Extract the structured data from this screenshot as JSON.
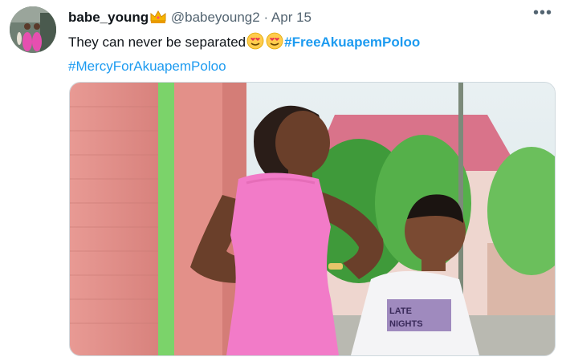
{
  "tweet": {
    "display_name": "babe_young",
    "name_emoji": "crown-emoji",
    "handle": "@babeyoung2",
    "separator": "·",
    "date": "Apr 15",
    "more_label": "•••",
    "text_line1": "They can never be separated",
    "text_emojis": [
      "smiling-face-with-heart-eyes-emoji",
      "smiling-face-with-heart-eyes-emoji"
    ],
    "hashtag1": "#FreeAkuapemPoloo",
    "hashtag2": "#MercyForAkuapemPoloo",
    "media_description_icon": "photo-icon",
    "shirt_text": "LATE NIGHTS"
  },
  "colors": {
    "link": "#1d9bf0",
    "text": "#0f1419",
    "secondary": "#536471",
    "border": "#cfd9de",
    "dress": "#f27bc8"
  }
}
